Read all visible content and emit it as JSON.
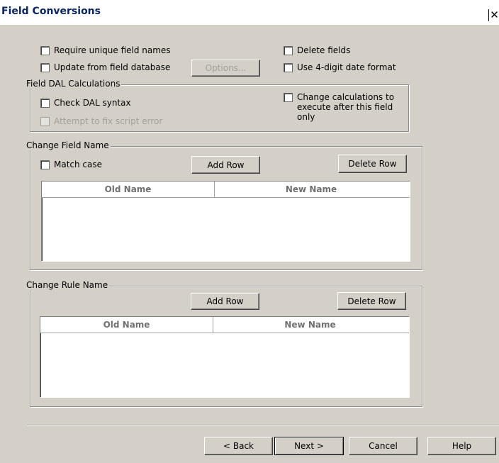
{
  "window": {
    "title": "Field Conversions",
    "close_glyph": "✕"
  },
  "options": {
    "require_unique": {
      "label": "Require unique field names",
      "checked": false
    },
    "update_from_db": {
      "label": "Update from field database",
      "checked": false
    },
    "options_button": "Options...",
    "delete_fields": {
      "label": "Delete fields",
      "checked": false
    },
    "use_4digit": {
      "label": "Use 4-digit date format",
      "checked": false
    }
  },
  "dal": {
    "legend": "Field DAL Calculations",
    "check_syntax": {
      "label": "Check DAL syntax",
      "checked": false
    },
    "fix_script": {
      "label": "Attempt to fix script error",
      "checked": false,
      "disabled": true
    },
    "change_calc": {
      "label_line1": "Change calculations to",
      "label_line2": "execute after this field",
      "label_line3": "only",
      "checked": false
    }
  },
  "field_name": {
    "legend": "Change Field Name",
    "match_case": {
      "label": "Match case",
      "checked": false
    },
    "add_row": "Add Row",
    "delete_row": "Delete Row",
    "columns": [
      "Old Name",
      "New Name"
    ],
    "rows": []
  },
  "rule_name": {
    "legend": "Change Rule Name",
    "add_row": "Add Row",
    "delete_row": "Delete Row",
    "columns": [
      "Old Name",
      "New Name"
    ],
    "rows": []
  },
  "footer": {
    "back": "< Back",
    "next": "Next >",
    "cancel": "Cancel",
    "help": "Help"
  }
}
